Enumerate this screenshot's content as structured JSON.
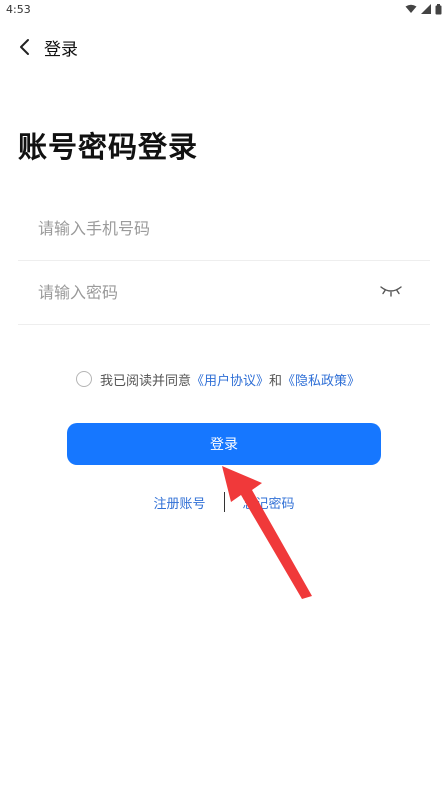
{
  "status_bar": {
    "time": "4:53"
  },
  "header": {
    "title": "登录"
  },
  "page_title": "账号密码登录",
  "phone_field": {
    "placeholder": "请输入手机号码",
    "value": ""
  },
  "password_field": {
    "placeholder": "请输入密码",
    "value": ""
  },
  "agreement": {
    "prefix": "我已阅读并同意",
    "user_agreement": "《用户协议》",
    "conjunction": "和",
    "privacy_policy": "《隐私政策》"
  },
  "login_button": {
    "label": "登录"
  },
  "bottom_links": {
    "register": "注册账号",
    "forgot": "忘记密码"
  },
  "colors": {
    "primary": "#1677ff",
    "link": "#2f6fd6",
    "arrow": "#f0393a"
  },
  "icons": {
    "back": "chevron-left-icon",
    "eye": "eye-closed-icon",
    "wifi": "wifi-icon",
    "signal": "signal-icon",
    "battery": "battery-icon"
  }
}
